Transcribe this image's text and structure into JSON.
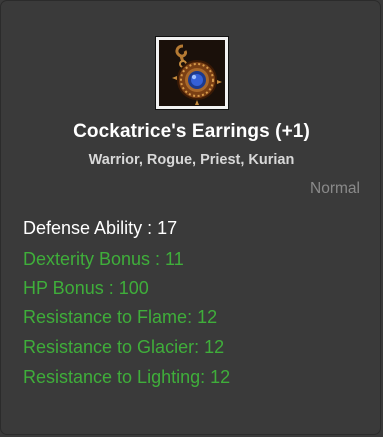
{
  "item": {
    "icon": "cockatrice-earring-icon",
    "name": "Cockatrice's Earrings (+1)",
    "classes": "Warrior, Rogue, Priest, Kurian",
    "grade": "Normal"
  },
  "stats": {
    "defense": "Defense Ability : 17",
    "dexterity": "Dexterity Bonus : 11",
    "hp": "HP Bonus : 100",
    "flame": "Resistance to Flame: 12",
    "glacier": "Resistance to Glacier: 12",
    "lighting": "Resistance to Lighting: 12"
  },
  "colors": {
    "background": "#3a3a3a",
    "title": "#ffffff",
    "classes": "#d8d8d8",
    "grade": "#8a8a8a",
    "base_stat": "#ffffff",
    "bonus_stat": "#3fae3a"
  }
}
